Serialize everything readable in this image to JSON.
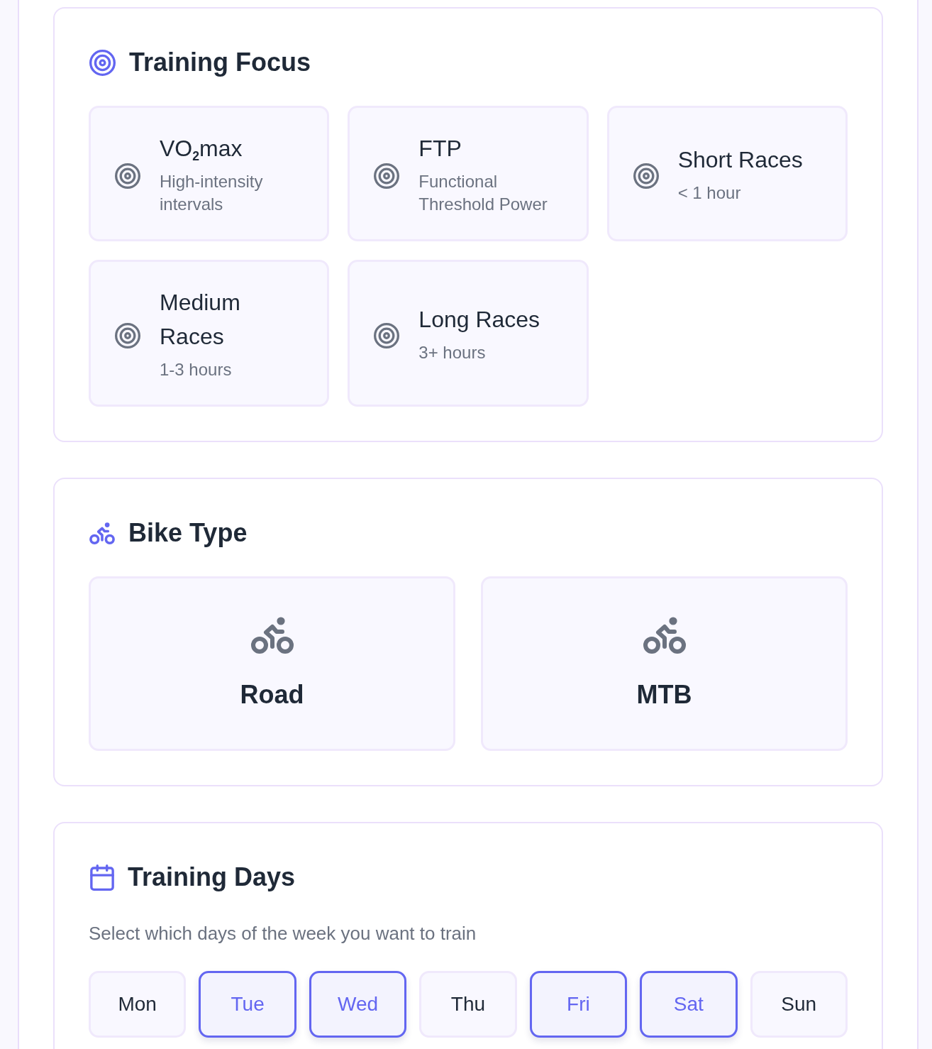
{
  "training_focus": {
    "title": "Training Focus",
    "options": [
      {
        "title": "VO$_{2}$max",
        "subtitle": "High-intensity intervals",
        "selected": false
      },
      {
        "title": "FTP",
        "subtitle": "Functional Threshold Power",
        "selected": false
      },
      {
        "title": "Short Races",
        "subtitle": "< 1 hour",
        "selected": false
      },
      {
        "title": "Medium Races",
        "subtitle": "1-3 hours",
        "selected": false
      },
      {
        "title": "Long Races",
        "subtitle": "3+ hours",
        "selected": false
      }
    ]
  },
  "bike_type": {
    "title": "Bike Type",
    "options": [
      {
        "label": "Road",
        "selected": false
      },
      {
        "label": "MTB",
        "selected": false
      }
    ]
  },
  "training_days": {
    "title": "Training Days",
    "description": "Select which days of the week you want to train",
    "days": [
      {
        "label": "Mon",
        "selected": false
      },
      {
        "label": "Tue",
        "selected": true
      },
      {
        "label": "Wed",
        "selected": true
      },
      {
        "label": "Thu",
        "selected": false
      },
      {
        "label": "Fri",
        "selected": true
      },
      {
        "label": "Sat",
        "selected": true
      },
      {
        "label": "Sun",
        "selected": false
      }
    ]
  }
}
